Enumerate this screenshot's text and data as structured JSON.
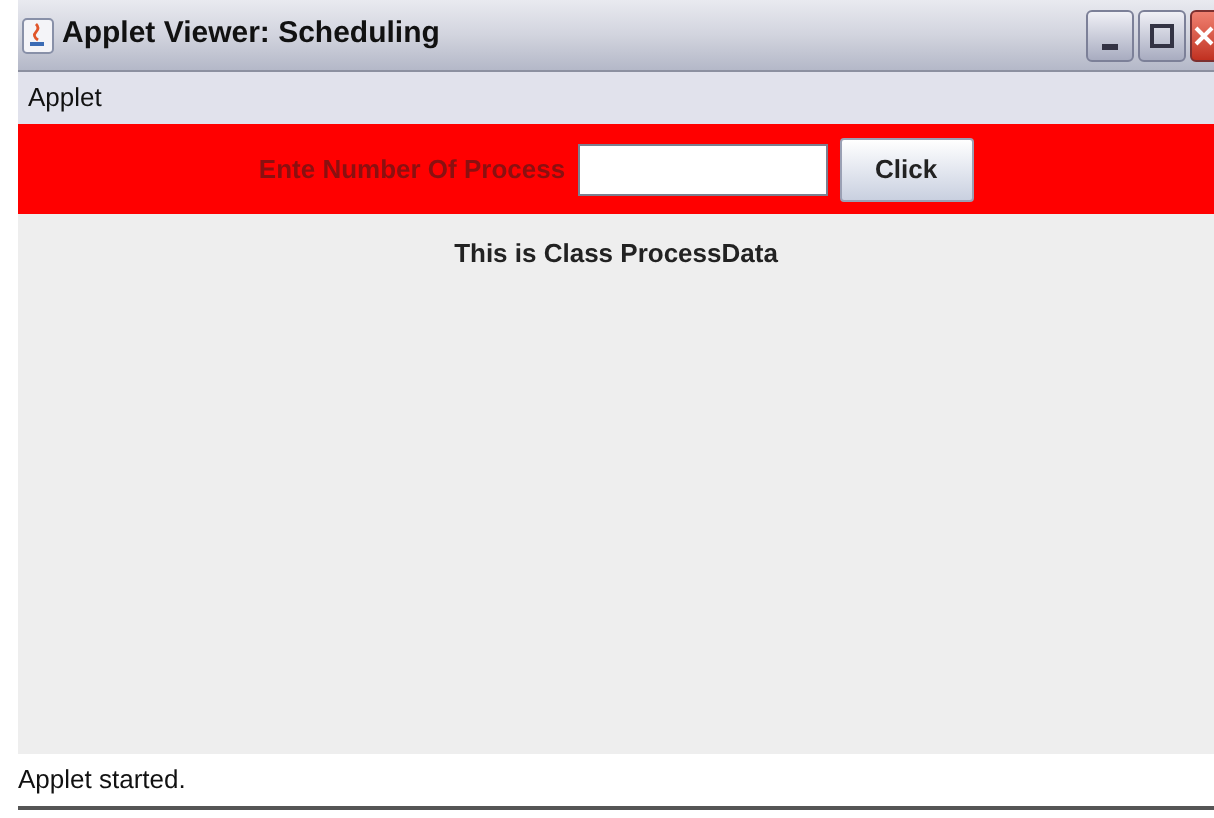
{
  "window": {
    "title": "Applet Viewer: Scheduling"
  },
  "menu": [
    "Applet"
  ],
  "form": {
    "label": "Ente Number Of Process",
    "button": "Click"
  },
  "content": {
    "heading": "This is Class ProcessData"
  },
  "status_bar": "Applet started."
}
